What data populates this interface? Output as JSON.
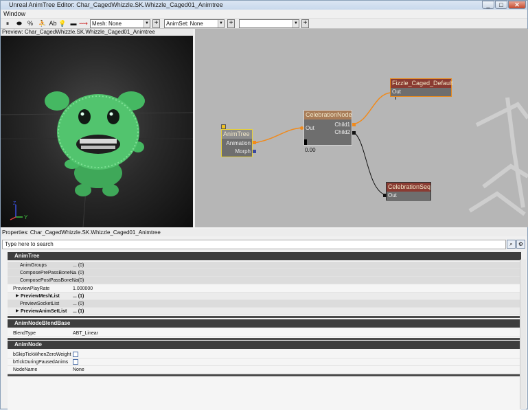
{
  "window": {
    "title": "Unreal AnimTree Editor: Char_CagedWhizzle.SK.Whizzle_Caged01_Animtree",
    "controls": [
      "_",
      "□",
      "✕"
    ]
  },
  "menu": {
    "items": [
      "Window"
    ]
  },
  "toolbar": {
    "pause": "⏸",
    "show_mesh": "⬬",
    "percent": "%",
    "skeleton": "⛹",
    "ab": "Ab",
    "bulb": "💡",
    "flat": "▬",
    "curve": "⟿",
    "mesh_combo": "Mesh: None",
    "animset_combo": "AnimSet: None",
    "third_combo": "",
    "plus": "+"
  },
  "preview": {
    "title": "Preview: Char_CagedWhizzle.SK.Whizzle_Caged01_Animtree",
    "axis_y": "Y",
    "axis_z": "Z"
  },
  "graph": {
    "animtree": {
      "title": "AnimTree",
      "pins": [
        "Animation",
        "Morph"
      ]
    },
    "celebration": {
      "title": "CelebrationNode",
      "in": "Out",
      "outs": [
        "Child1",
        "Child2"
      ],
      "value": "0.00"
    },
    "fizzle": {
      "title": "Fizzle_Caged_Default",
      "out": "Out"
    },
    "celebseq": {
      "title": "CelebrationSeq",
      "out": "Out"
    },
    "colors": {
      "wire": "#f08a1c",
      "header_orange": "#c98046",
      "header_red": "#8a3b32"
    }
  },
  "properties": {
    "header": "Properties: Char_CagedWhizzle.SK.Whizzle_Caged01_Animtree",
    "search_placeholder": "Type here to search",
    "cat_animtree": "AnimTree",
    "animtree_rows": [
      {
        "k": "AnimGroups",
        "v": "... (0)"
      },
      {
        "k": "ComposePrePassBoneNa",
        "v": "... (0)"
      },
      {
        "k": "ComposePostPassBoneNa",
        "v": "... (0)"
      },
      {
        "k": "PreviewPlayRate",
        "v": "1.000000"
      },
      {
        "k": "PreviewMeshList",
        "v": "... (1)"
      },
      {
        "k": "PreviewSocketList",
        "v": "... (0)"
      },
      {
        "k": "PreviewAnimSetList",
        "v": "... (1)"
      }
    ],
    "cat_blend": "AnimNodeBlendBase",
    "blend_rows": [
      {
        "k": "BlendType",
        "v": "ABT_Linear"
      }
    ],
    "cat_node": "AnimNode",
    "node_rows": [
      {
        "k": "bSkipTickWhenZeroWeight",
        "v": ""
      },
      {
        "k": "bTickDuringPausedAnims",
        "v": ""
      },
      {
        "k": "NodeName",
        "v": "None"
      }
    ],
    "expand_arrow": "▶"
  }
}
